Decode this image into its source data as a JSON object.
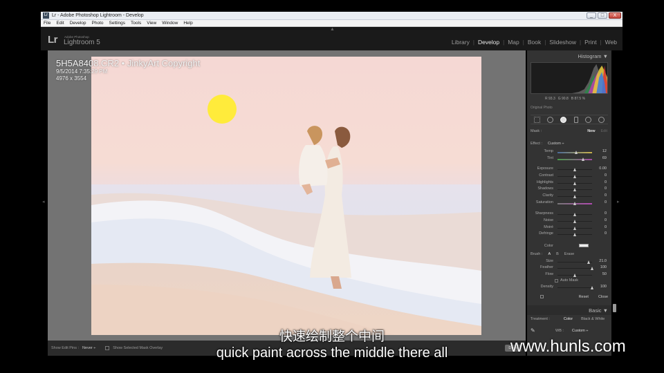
{
  "window": {
    "title": "Lr - Adobe Photoshop Lightroom - Develop",
    "icon_label": "Lr",
    "controls": [
      "_",
      "□",
      "X"
    ]
  },
  "menu": [
    "File",
    "Edit",
    "Develop",
    "Photo",
    "Settings",
    "Tools",
    "View",
    "Window",
    "Help"
  ],
  "app": {
    "logo": "Lr",
    "product_small": "Adobe Photoshop",
    "product": "Lightroom 5",
    "top_arrow": "▲",
    "modules": [
      {
        "label": "Library",
        "active": false
      },
      {
        "label": "Develop",
        "active": true
      },
      {
        "label": "Map",
        "active": false
      },
      {
        "label": "Book",
        "active": false
      },
      {
        "label": "Slideshow",
        "active": false
      },
      {
        "label": "Print",
        "active": false
      },
      {
        "label": "Web",
        "active": false
      }
    ],
    "module_separator": "|"
  },
  "photo_info": {
    "filename": "5H5A8408.CR2 • JinkyArt Copyright",
    "date": "9/5/2014 7:35:29 PM",
    "dimensions": "4976 x 3554"
  },
  "edge_arrows": {
    "left": "◂",
    "right": "▸"
  },
  "toolbar": {
    "show_edit_pins_label": "Show Edit Pins :",
    "show_edit_pins_value": "Never ÷",
    "show_mask_label": "Show Selected Mask Overlay",
    "done_label": "Done"
  },
  "right_panel": {
    "histogram_label": "Histogram ▼",
    "rgb": {
      "r": "R  93.3",
      "g": "G  90.8",
      "b": "B  87.5 %"
    },
    "original_photo": "Original Photo",
    "mask_label": "Mask :",
    "mask_new": "New",
    "mask_edit": "Edit",
    "effect_label": "Effect :",
    "effect_value": "Custom ÷",
    "sliders_group1": [
      {
        "name": "Temp",
        "value": "12",
        "pos": 0.55,
        "track": "temp"
      },
      {
        "name": "Tint",
        "value": "69",
        "pos": 0.75,
        "track": "tint"
      }
    ],
    "sliders_group2": [
      {
        "name": "Exposure",
        "value": "0.00",
        "pos": 0.5,
        "track": ""
      },
      {
        "name": "Contrast",
        "value": "0",
        "pos": 0.5,
        "track": ""
      },
      {
        "name": "Highlights",
        "value": "0",
        "pos": 0.5,
        "track": ""
      },
      {
        "name": "Shadows",
        "value": "0",
        "pos": 0.5,
        "track": ""
      },
      {
        "name": "Clarity",
        "value": "0",
        "pos": 0.5,
        "track": ""
      },
      {
        "name": "Saturation",
        "value": "0",
        "pos": 0.5,
        "track": "sat"
      }
    ],
    "sliders_group3": [
      {
        "name": "Sharpness",
        "value": "0",
        "pos": 0.5,
        "track": ""
      },
      {
        "name": "Noise",
        "value": "0",
        "pos": 0.5,
        "track": ""
      },
      {
        "name": "Moiré",
        "value": "0",
        "pos": 0.5,
        "track": ""
      },
      {
        "name": "Defringe",
        "value": "0",
        "pos": 0.5,
        "track": ""
      }
    ],
    "color_label": "Color",
    "brush_label": "Brush :",
    "brush_a": "A",
    "brush_b": "B",
    "brush_erase": "Erase",
    "brush_sliders": [
      {
        "name": "Size",
        "value": "21.0",
        "pos": 0.9,
        "track": ""
      },
      {
        "name": "Feather",
        "value": "100",
        "pos": 1.0,
        "track": ""
      },
      {
        "name": "Flow",
        "value": "50",
        "pos": 0.5,
        "track": ""
      }
    ],
    "auto_mask": "Auto Mask",
    "density": {
      "name": "Density",
      "value": "100",
      "pos": 1.0,
      "track": ""
    },
    "reset": "Reset",
    "close": "Close",
    "basic_label": "Basic ▼",
    "treatment_label": "Treatment :",
    "treatment_color": "Color",
    "treatment_bw": "Black & White",
    "wb_label": "WB :",
    "wb_value": "Custom ÷"
  },
  "subtitles": {
    "chinese": "快速绘制整个中间",
    "english": "quick paint across the middle there all"
  },
  "watermark": "www.hunls.com"
}
